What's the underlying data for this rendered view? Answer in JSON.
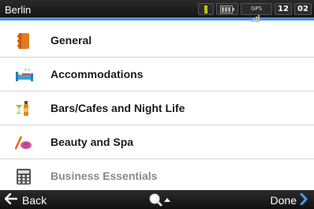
{
  "status_bar": {
    "title": "Berlin",
    "icons": [
      "battery-charging-icon",
      "battery-level-icon",
      "gps-signal-icon"
    ],
    "gps_label": "GPS",
    "hours": "12",
    "minutes": "02"
  },
  "menu": {
    "items": [
      {
        "label": "General",
        "icon": "notebook-icon"
      },
      {
        "label": "Accommodations",
        "icon": "bed-icon"
      },
      {
        "label": "Bars/Cafes and Night Life",
        "icon": "drinks-icon"
      },
      {
        "label": "Beauty and Spa",
        "icon": "spa-icon"
      },
      {
        "label": "Business Essentials",
        "icon": "calculator-icon"
      }
    ]
  },
  "bottom_bar": {
    "back_label": "Back",
    "done_label": "Done",
    "search_icon": "search-icon"
  },
  "colors": {
    "accent": "#4a90d9",
    "bar_bg": "#1a1a1a",
    "done_chevron": "#4a9be8"
  }
}
